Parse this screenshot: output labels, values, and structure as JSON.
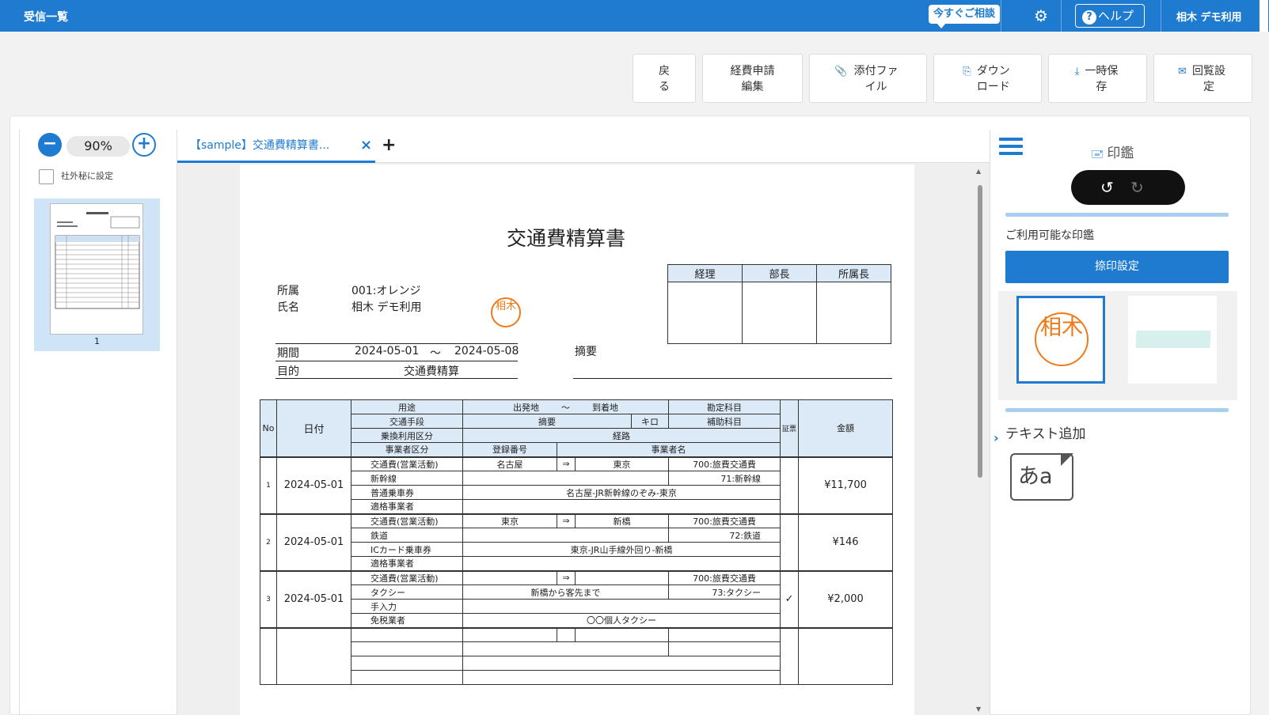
{
  "header": {
    "title": "受信一覧",
    "consult": "今すぐご相談",
    "help": "ヘルプ",
    "user": "相木 デモ利用"
  },
  "toolbar": {
    "back": "戻る",
    "edit_expense": "経費申請編集",
    "attach": "添付ファイル",
    "download": "ダウンロード",
    "save_temp": "一時保存",
    "circulation": "回覧設定"
  },
  "left": {
    "zoom": "90%",
    "confidential": "社外秘に設定",
    "page_number": "1"
  },
  "tabs": {
    "doc_tab": "【sample】交通費精算書..."
  },
  "document": {
    "title": "交通費精算書",
    "affiliation_label": "所属",
    "affiliation": "001:オレンジ",
    "name_label": "氏名",
    "name": "相木 デモ利用",
    "period_label": "期間",
    "period_from": "2024-05-01",
    "tilde": "～",
    "period_to": "2024-05-08",
    "purpose_label": "目的",
    "purpose": "交通費精算",
    "summary_label": "摘要",
    "approvals": [
      "経理",
      "部長",
      "所属長"
    ],
    "stamp_chars": "相木",
    "table": {
      "no": "No",
      "date": "日付",
      "use": "用途",
      "from": "出発地",
      "tilde": "～",
      "to": "到着地",
      "account": "勘定科目",
      "means": "交通手段",
      "desc": "摘要",
      "km": "キロ",
      "sub_account": "補助科目",
      "transfer": "乗換利用区分",
      "route": "経路",
      "biz_type": "事業者区分",
      "reg_no": "登録番号",
      "biz_name": "事業者名",
      "receipt": "証票",
      "amount": "金額",
      "arrow": "⇒",
      "rows": [
        {
          "no": "1",
          "date": "2024-05-01",
          "use": "交通費(営業活動)",
          "from": "名古屋",
          "to": "東京",
          "account": "700:旅費交通費",
          "means": "新幹線",
          "sub": "71:新幹線",
          "transfer": "普通乗車券",
          "route": "名古屋-JR新幹線のぞみ-東京",
          "biz": "適格事業者",
          "receipt": "",
          "amount": "¥11,700",
          "biz_name": "",
          "desc": ""
        },
        {
          "no": "2",
          "date": "2024-05-01",
          "use": "交通費(営業活動)",
          "from": "東京",
          "to": "新橋",
          "account": "700:旅費交通費",
          "means": "鉄道",
          "sub": "72:鉄道",
          "transfer": "ICカード乗車券",
          "route": "東京-JR山手線外回り-新橋",
          "biz": "適格事業者",
          "receipt": "",
          "amount": "¥146",
          "biz_name": "",
          "desc": ""
        },
        {
          "no": "3",
          "date": "2024-05-01",
          "use": "交通費(営業活動)",
          "from": "",
          "to": "",
          "account": "700:旅費交通費",
          "means": "タクシー",
          "sub": "73:タクシー",
          "transfer": "手入力",
          "route": "",
          "biz": "免税業者",
          "receipt": "✓",
          "amount": "¥2,000",
          "biz_name": "〇〇個人タクシー",
          "desc": "新橋から客先まで"
        }
      ]
    }
  },
  "right": {
    "panel_title": "印鑑",
    "available": "ご利用可能な印鑑",
    "press_settings": "捺印設定",
    "seal_chars": "相木",
    "text_add": "テキスト追加",
    "text_icon": "あa"
  }
}
